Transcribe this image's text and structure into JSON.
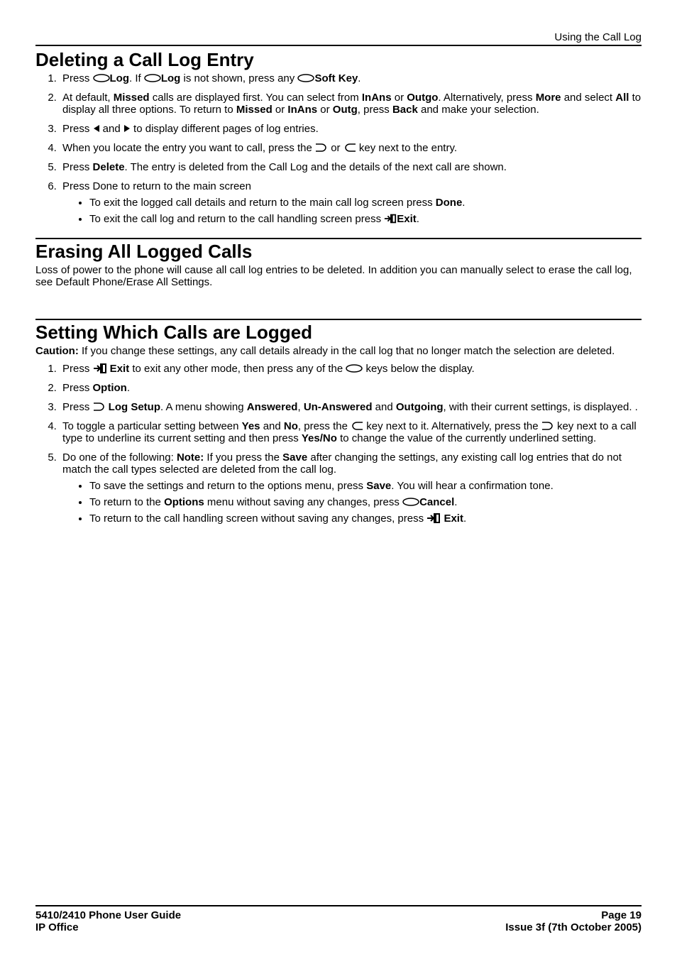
{
  "header": {
    "chapter": "Using the Call Log"
  },
  "sec1": {
    "title": "Deleting a Call Log Entry",
    "step1_a": "Press ",
    "step1_b": "Log",
    "step1_c": ". If ",
    "step1_d": "Log",
    "step1_e": " is not shown, press any ",
    "step1_f": "Soft Key",
    "step1_g": ".",
    "step2_a": "At default, ",
    "step2_b": "Missed",
    "step2_c": " calls are displayed first. You can select from ",
    "step2_d": "InAns",
    "step2_e": " or ",
    "step2_f": "Outgo",
    "step2_g": ". Alternatively, press ",
    "step2_h": "More",
    "step2_i": " and select ",
    "step2_j": "All",
    "step2_k": " to display all three options. To return to ",
    "step2_l": "Missed",
    "step2_m": " or ",
    "step2_n": "InAns",
    "step2_o": " or ",
    "step2_p": "Outg",
    "step2_q": ", press ",
    "step2_r": "Back",
    "step2_s": " and make your selection.",
    "step3_a": "Press ",
    "step3_b": " and ",
    "step3_c": " to display different pages of log entries.",
    "step4_a": "When you locate the entry you want to call, press the ",
    "step4_b": " or ",
    "step4_c": " key next to the entry.",
    "step5_a": "Press ",
    "step5_b": "Delete",
    "step5_c": ". The entry is deleted from the Call Log and the details of the next call are shown.",
    "step6": "Press Done to return to the main screen",
    "b1_a": "To exit the logged call details and return to the main call log screen press ",
    "b1_b": "Done",
    "b1_c": ".",
    "b2_a": "To exit the call log and return to the call handling screen press ",
    "b2_b": "Exit",
    "b2_c": "."
  },
  "sec2": {
    "title": "Erasing All Logged Calls",
    "p": "Loss of power to the phone will cause all call log entries to be deleted. In addition you can manually select to erase the call log, see Default Phone/Erase All Settings."
  },
  "sec3": {
    "title": "Setting Which Calls are Logged",
    "caution_a": "Caution:",
    "caution_b": " If you change these settings, any call details already in the call log that no longer match the selection are deleted.",
    "step1_a": "Press ",
    "step1_b": " Exit",
    "step1_c": " to exit any other mode, then press any of the ",
    "step1_d": " keys below the display.",
    "step2_a": "Press ",
    "step2_b": "Option",
    "step2_c": ".",
    "step3_a": "Press ",
    "step3_b": " Log Setup",
    "step3_c": ". A menu showing ",
    "step3_d": "Answered",
    "step3_e": ", ",
    "step3_f": "Un-Answered",
    "step3_g": " and ",
    "step3_h": "Outgoing",
    "step3_i": ", with their current settings, is displayed. .",
    "step4_a": "To toggle a particular setting between ",
    "step4_b": "Yes",
    "step4_c": " and ",
    "step4_d": "No",
    "step4_e": ", press the ",
    "step4_f": " key next to it. Alternatively, press the ",
    "step4_g": " key next to a call type to underline its current setting and then press ",
    "step4_h": "Yes/No",
    "step4_i": " to change the value of the currently underlined setting.",
    "step5_a": "Do one of the following: ",
    "step5_b": "Note:",
    "step5_c": "  If you press the ",
    "step5_d": "Save",
    "step5_e": " after changing the settings, any existing call log entries that do not match the call types selected are deleted from the call log.",
    "b1_a": "To save the settings and return to the options menu, press ",
    "b1_b": "Save",
    "b1_c": ". You will hear a confirmation tone.",
    "b2_a": "To return to the ",
    "b2_b": "Options",
    "b2_c": " menu without saving any changes, press ",
    "b2_d": "Cancel",
    "b2_e": ".",
    "b3_a": "To return to the call handling screen without saving any changes, press ",
    "b3_b": " Exit",
    "b3_c": "."
  },
  "footer": {
    "l1": "5410/2410 Phone User Guide",
    "l2": "IP Office",
    "r1": "Page 19",
    "r2": "Issue 3f (7th October 2005)"
  }
}
